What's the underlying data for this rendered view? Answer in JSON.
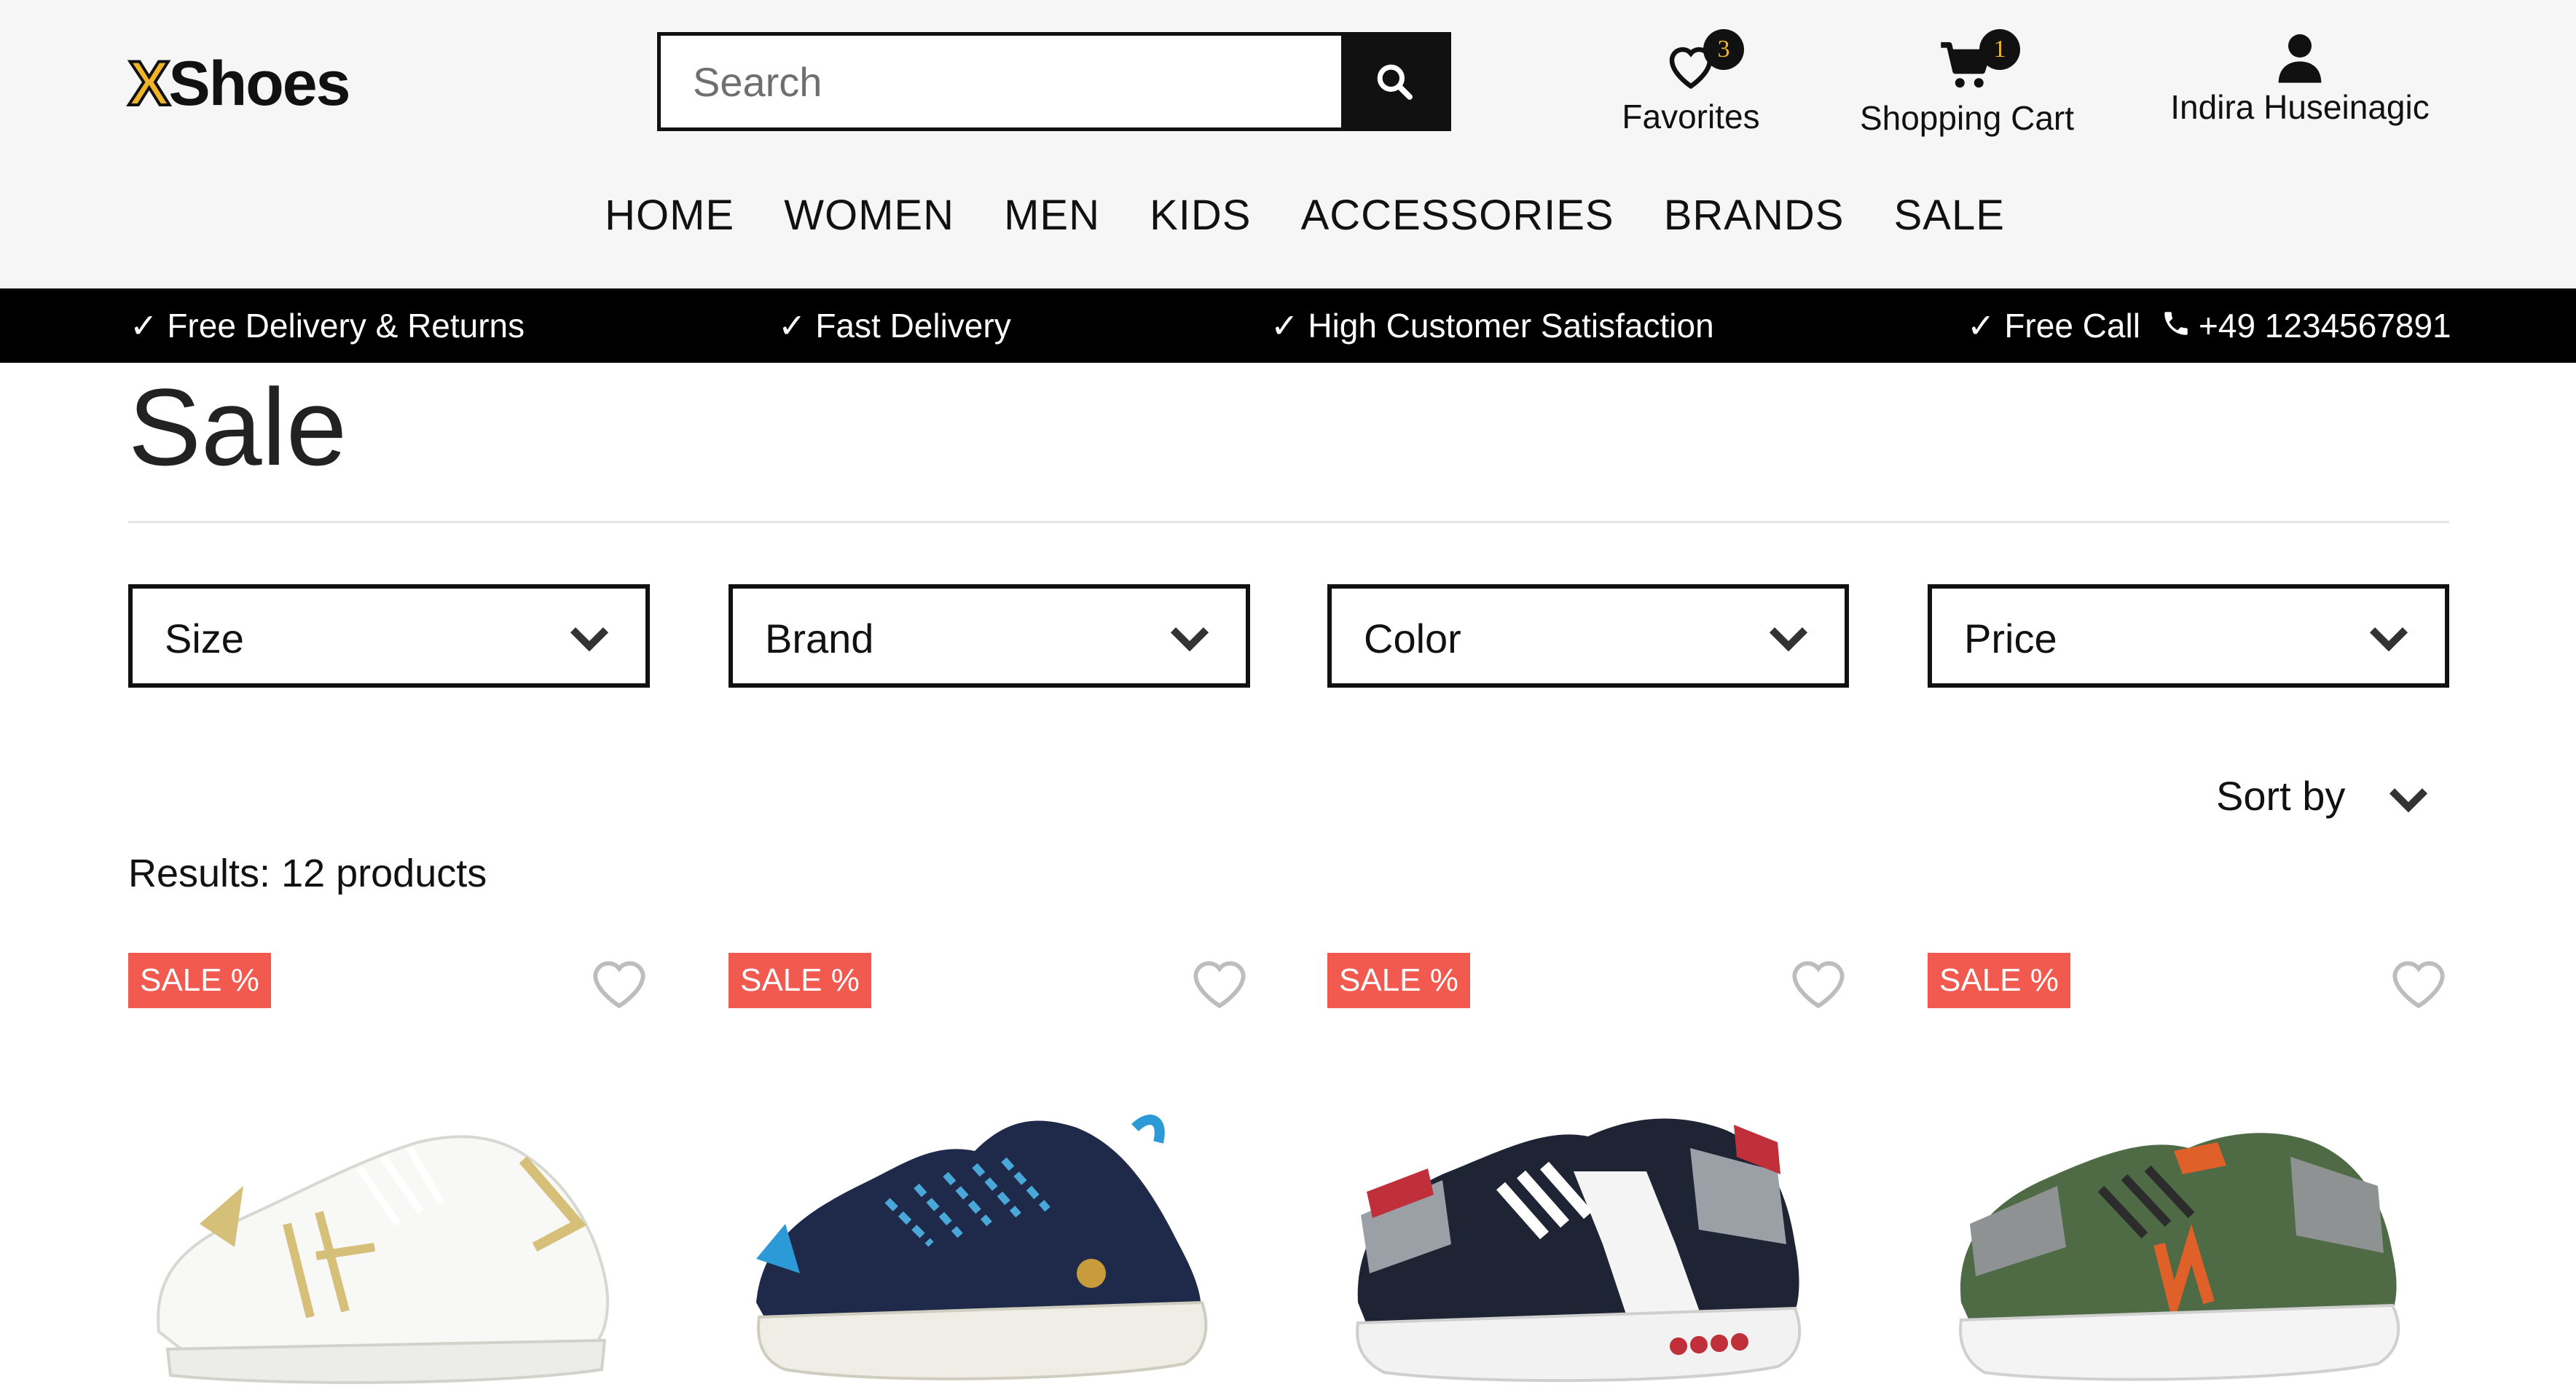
{
  "logo": {
    "x": "X",
    "rest": "Shoes"
  },
  "search": {
    "placeholder": "Search"
  },
  "header": {
    "favorites": {
      "label": "Favorites",
      "count": "3"
    },
    "cart": {
      "label": "Shopping Cart",
      "count": "1"
    },
    "user": {
      "label": "Indira Huseinagic"
    }
  },
  "nav": [
    "HOME",
    "WOMEN",
    "MEN",
    "KIDS",
    "ACCESSORIES",
    "BRANDS",
    "SALE"
  ],
  "infobar": {
    "delivery": "✓ Free Delivery & Returns",
    "fast": "✓ Fast Delivery",
    "satisfaction": "✓ High Customer Satisfaction",
    "call": "✓ Free Call",
    "phone": "+49 1234567891"
  },
  "page": {
    "title": "Sale"
  },
  "filters": [
    "Size",
    "Brand",
    "Color",
    "Price"
  ],
  "sort": {
    "label": "Sort by"
  },
  "results": "Results: 12 products",
  "products": [
    {
      "badge": "SALE %",
      "icon": "white-sneaker",
      "color": "#f7f7f5"
    },
    {
      "badge": "SALE %",
      "icon": "navy-knit-sneaker",
      "color": "#1f2a4a"
    },
    {
      "badge": "SALE %",
      "icon": "black-red-sneaker",
      "color": "#1e2433"
    },
    {
      "badge": "SALE %",
      "icon": "green-grey-sneaker",
      "color": "#4f6b45"
    }
  ],
  "colors": {
    "accent": "#f0b428",
    "sale": "#f25a50",
    "bar": "#000000",
    "header_bg": "#f6f6f7"
  }
}
